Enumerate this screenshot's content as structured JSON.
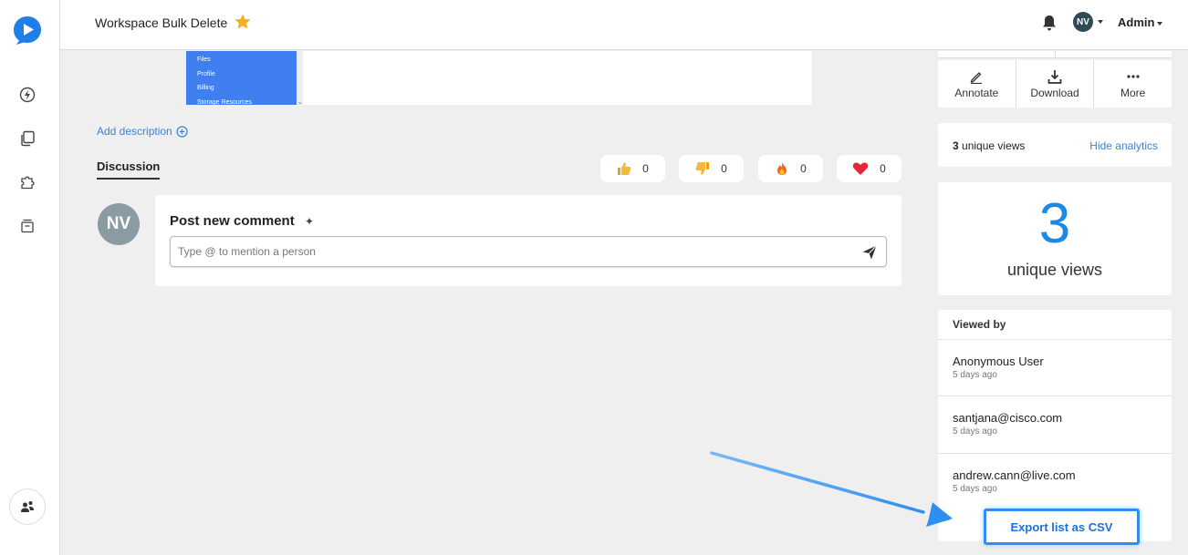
{
  "header": {
    "title": "Workspace Bulk Delete",
    "avatar_initials": "NV",
    "user_menu_label": "Admin"
  },
  "sidebar": {
    "items": [
      {
        "icon": "lightning-icon"
      },
      {
        "icon": "copy-pages-icon"
      },
      {
        "icon": "puzzle-icon"
      },
      {
        "icon": "archive-icon"
      }
    ],
    "bottom_icon": "team-icon"
  },
  "thumbnail": {
    "menu_items": [
      "Files",
      "Profile",
      "Billing",
      "Storage Resources"
    ]
  },
  "main": {
    "add_description_label": "Add description",
    "discussion_tab_label": "Discussion",
    "reactions": [
      {
        "icon": "thumbs-up-icon",
        "count": "0"
      },
      {
        "icon": "thumbs-down-icon",
        "count": "0"
      },
      {
        "icon": "fire-icon",
        "count": "0"
      },
      {
        "icon": "heart-icon",
        "count": "0"
      }
    ],
    "comment": {
      "avatar_initials": "NV",
      "title": "Post new comment",
      "placeholder": "Type @ to mention a person"
    }
  },
  "right_panel": {
    "actions": [
      {
        "label": "Annotate",
        "icon": "pen-icon"
      },
      {
        "label": "Download",
        "icon": "download-icon"
      },
      {
        "label": "More",
        "icon": "more-dots-icon"
      }
    ],
    "views_count": "3",
    "views_suffix": "unique views",
    "hide_analytics_label": "Hide analytics",
    "big_number": "3",
    "big_label": "unique views",
    "viewed_by_title": "Viewed by",
    "viewers": [
      {
        "name": "Anonymous User",
        "time": "5 days ago"
      },
      {
        "name": "santjana@cisco.com",
        "time": "5 days ago"
      },
      {
        "name": "andrew.cann@live.com",
        "time": "5 days ago"
      }
    ],
    "export_label": "Export list as CSV"
  },
  "colors": {
    "accent": "#1e88e5",
    "link": "#3b82d6",
    "highlight_border": "#2e8ff0",
    "star": "#f2b01e",
    "avatar_dark": "#2e4a54"
  }
}
